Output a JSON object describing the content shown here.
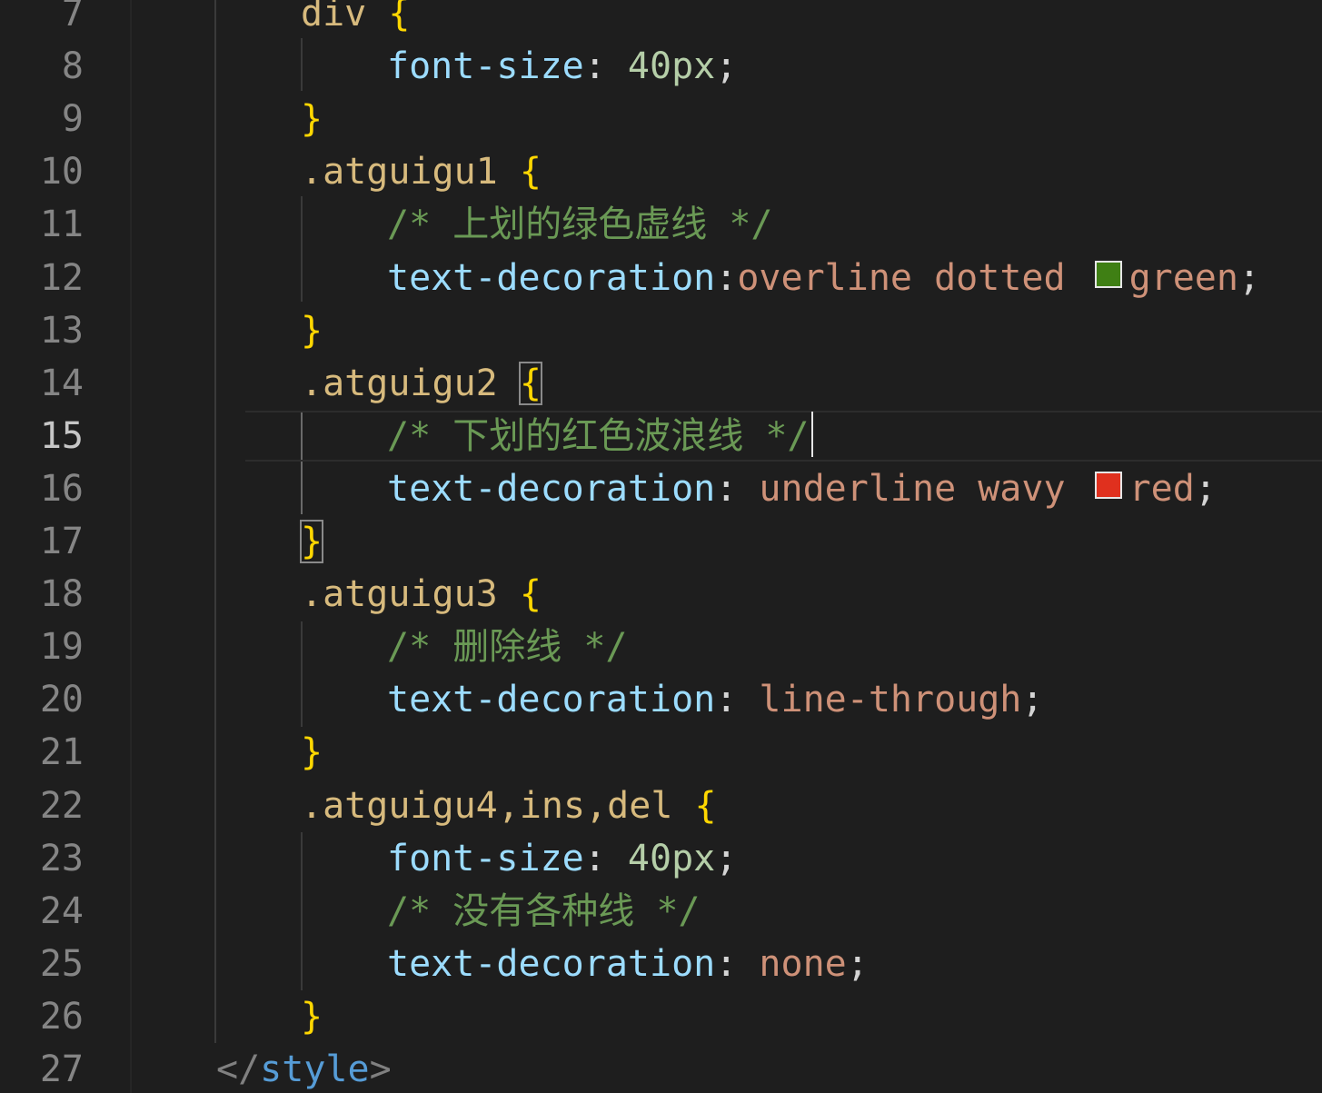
{
  "editor": {
    "active_line": 15,
    "colors": {
      "background": "#1e1e1e",
      "selector": "#d7ba7d",
      "brace": "#ffd700",
      "property": "#9cdcfe",
      "value": "#ce9178",
      "comment": "#6a9955",
      "green_swatch": "#3f7f14",
      "red_swatch": "#e0301e"
    },
    "lines": [
      {
        "n": "7",
        "sel": "div",
        "brace": "{"
      },
      {
        "n": "8",
        "prop": "font-size",
        "colon": ": ",
        "num": "40px",
        "semi": ";"
      },
      {
        "n": "9",
        "brace": "}"
      },
      {
        "n": "10",
        "sel": ".atguigu1",
        "brace": "{"
      },
      {
        "n": "11",
        "comment": "/* 上划的绿色虚线 */"
      },
      {
        "n": "12",
        "prop": "text-decoration",
        "colon": ":",
        "val": "overline dotted",
        "swatch_val": "green",
        "semi": ";"
      },
      {
        "n": "13",
        "brace": "}"
      },
      {
        "n": "14",
        "sel": ".atguigu2",
        "brace": "{"
      },
      {
        "n": "15",
        "comment": "/* 下划的红色波浪线 */"
      },
      {
        "n": "16",
        "prop": "text-decoration",
        "colon": ": ",
        "val": "underline wavy",
        "swatch_val": "red",
        "semi": ";"
      },
      {
        "n": "17",
        "brace": "}"
      },
      {
        "n": "18",
        "sel": ".atguigu3",
        "brace": "{"
      },
      {
        "n": "19",
        "comment": "/* 删除线 */"
      },
      {
        "n": "20",
        "prop": "text-decoration",
        "colon": ": ",
        "val": "line-through",
        "semi": ";"
      },
      {
        "n": "21",
        "brace": "}"
      },
      {
        "n": "22",
        "sel": ".atguigu4,ins,del",
        "brace": "{"
      },
      {
        "n": "23",
        "prop": "font-size",
        "colon": ": ",
        "num": "40px",
        "semi": ";"
      },
      {
        "n": "24",
        "comment": "/* 没有各种线 */"
      },
      {
        "n": "25",
        "prop": "text-decoration",
        "colon": ": ",
        "val": "none",
        "semi": ";"
      },
      {
        "n": "26",
        "brace": "}"
      },
      {
        "n": "27",
        "close_open": "</",
        "close_tag": "style",
        "close_end": ">"
      }
    ]
  }
}
